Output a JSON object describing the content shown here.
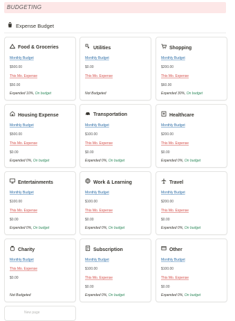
{
  "banner": {
    "text": "BUDGETING"
  },
  "section": {
    "icon": "shopping-bag-icon",
    "title": "Expense Budget"
  },
  "labels": {
    "budget": "Monthly Budget",
    "expense": "This Mo. Expense"
  },
  "cards": [
    {
      "icon": "mountain-icon",
      "title": "Food & Groceries",
      "budget": "$500.00",
      "expense": "$50.00",
      "expended": "Expended 10%,",
      "status": "On budget"
    },
    {
      "icon": "utilities-icon",
      "title": "Utilities",
      "budget": "$0.00",
      "expense": "",
      "expended": "Not Budgeted",
      "status": ""
    },
    {
      "icon": "shopping-cart-icon",
      "title": "Shopping",
      "budget": "$200.00",
      "expense": "$60.00",
      "expended": "Expended 30%,",
      "status": "On budget"
    },
    {
      "icon": "house-icon",
      "title": "Housing Expense",
      "budget": "$500.00",
      "expense": "$0.00",
      "expended": "Expended 0%,",
      "status": "On budget"
    },
    {
      "icon": "car-icon",
      "title": "Transportation",
      "budget": "$100.00",
      "expense": "$0.00",
      "expended": "Expended 0%,",
      "status": "On budget"
    },
    {
      "icon": "hospital-icon",
      "title": "Healthcare",
      "budget": "$200.00",
      "expense": "$0.00",
      "expended": "Expended 0%,",
      "status": "On budget"
    },
    {
      "icon": "monitor-icon",
      "title": "Entertainments",
      "budget": "$100.00",
      "expense": "$0.00",
      "expended": "Expended 0%,",
      "status": "On budget"
    },
    {
      "icon": "globe-icon",
      "title": "Work & Learning",
      "budget": "$100.00",
      "expense": "$0.00",
      "expended": "Expended 0%,",
      "status": "On budget"
    },
    {
      "icon": "airplane-icon",
      "title": "Travel",
      "budget": "$200.00",
      "expense": "$0.00",
      "expended": "Expended 0%,",
      "status": "On budget"
    },
    {
      "icon": "charity-jar-icon",
      "title": "Charity",
      "budget": "",
      "expense": "$0.00",
      "expended": "Not Budgeted",
      "status": ""
    },
    {
      "icon": "receipt-icon",
      "title": "Subscription",
      "budget": "$100.00",
      "expense": "$0.00",
      "expended": "Expended 0%,",
      "status": "On budget"
    },
    {
      "icon": "wallet-icon",
      "title": "Other",
      "budget": "$100.00",
      "expense": "$0.00",
      "expended": "Expended 0%,",
      "status": "On budget"
    }
  ],
  "add_card": {
    "label": "New page"
  },
  "colors": {
    "banner_bg": "#fde7e7",
    "budget_label": "#2e6ea6",
    "expense_label": "#d44c47",
    "on_budget": "#2f8a5c"
  }
}
